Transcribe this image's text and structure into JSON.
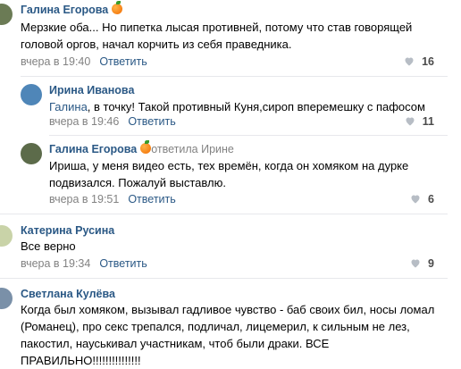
{
  "comments": [
    {
      "author": "Галина Егорова",
      "text": "Мерзкие оба... Но пипетка лысая противней, потому что став говорящей головой оргов, начал корчить из себя праведника.",
      "time": "вчера в 19:40",
      "reply_label": "Ответить",
      "likes": "16"
    },
    {
      "author": "Ирина Иванова",
      "reply_name": "Галина",
      "text": ", в точку! Такой противный Куня,сироп вперемешку с пафосом",
      "time": "вчера в 19:46",
      "reply_label": "Ответить",
      "likes": "11"
    },
    {
      "author": "Галина Егорова",
      "replied_to": "ответила Ирине",
      "text": "Ириша, у меня видео есть, тех времён, когда он хомяком на дурке подвизался. Пожалуй выставлю.",
      "time": "вчера в 19:51",
      "reply_label": "Ответить",
      "likes": "6"
    },
    {
      "author": "Катерина Русина",
      "text": "Все верно",
      "time": "вчера в 19:34",
      "reply_label": "Ответить",
      "likes": "9"
    },
    {
      "author": "Светлана Кулёва",
      "text": "Когда был хомяком, вызывал гадливое чувство - баб своих бил, носы ломал (Романец), про секс трепался, подличал, лицемерил, к сильным не лез, пакостил, науськивал участникам, чтоб были драки. ВСЕ ПРАВИЛЬНО!!!!!!!!!!!!!!!"
    }
  ],
  "colors": {
    "link": "#2a5885",
    "meta": "#828282",
    "divider": "#e7e8ec"
  }
}
